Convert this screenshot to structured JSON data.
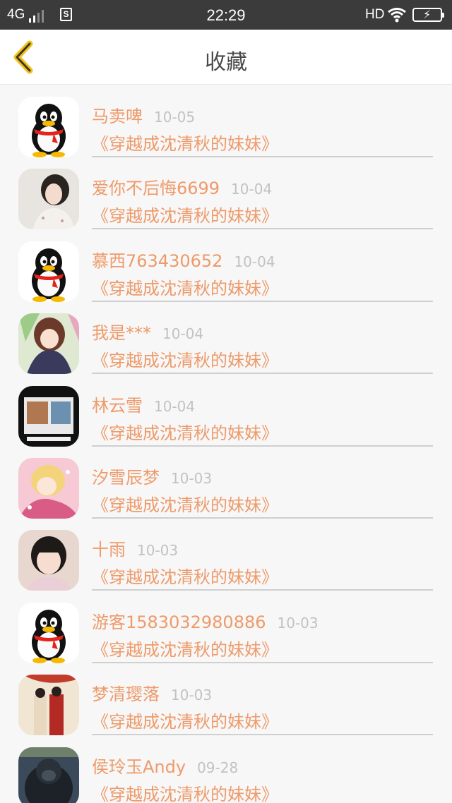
{
  "status_bar": {
    "network": "4G",
    "sim": "S",
    "time": "22:29",
    "hd": "HD",
    "icons": [
      "signal-icon",
      "sim-icon",
      "wifi-icon",
      "battery-charging-icon"
    ]
  },
  "header": {
    "back_icon": "chevron-left-icon",
    "title": "收藏"
  },
  "colors": {
    "accent": "#ee9a6a",
    "back_arrow": "#f0c21e",
    "date": "#c2c2c2",
    "status_bar": "#3b3b3b"
  },
  "favorites": [
    {
      "user": "马卖啤",
      "date": "10-05",
      "book": "《穿越成沈清秋的妹妹》",
      "avatar": "qq-penguin"
    },
    {
      "user": "爱你不后悔6699",
      "date": "10-04",
      "book": "《穿越成沈清秋的妹妹》",
      "avatar": "girl-photo"
    },
    {
      "user": "慕西763430652",
      "date": "10-04",
      "book": "《穿越成沈清秋的妹妹》",
      "avatar": "qq-penguin"
    },
    {
      "user": "我是***",
      "date": "10-04",
      "book": "《穿越成沈清秋的妹妹》",
      "avatar": "anime-girl"
    },
    {
      "user": "林云雪",
      "date": "10-04",
      "book": "《穿越成沈清秋的妹妹》",
      "avatar": "cute-children"
    },
    {
      "user": "汐雪辰梦",
      "date": "10-03",
      "book": "《穿越成沈清秋的妹妹》",
      "avatar": "anime-pink"
    },
    {
      "user": "十雨",
      "date": "10-03",
      "book": "《穿越成沈清秋的妹妹》",
      "avatar": "child-photo"
    },
    {
      "user": "游客1583032980886",
      "date": "10-03",
      "book": "《穿越成沈清秋的妹妹》",
      "avatar": "qq-penguin"
    },
    {
      "user": "梦清璎落",
      "date": "10-03",
      "book": "《穿越成沈清秋的妹妹》",
      "avatar": "ancient-couple"
    },
    {
      "user": "侯玲玉Andy",
      "date": "09-28",
      "book": "《穿越成沈清秋的妹妹》",
      "avatar": "gorilla"
    }
  ]
}
